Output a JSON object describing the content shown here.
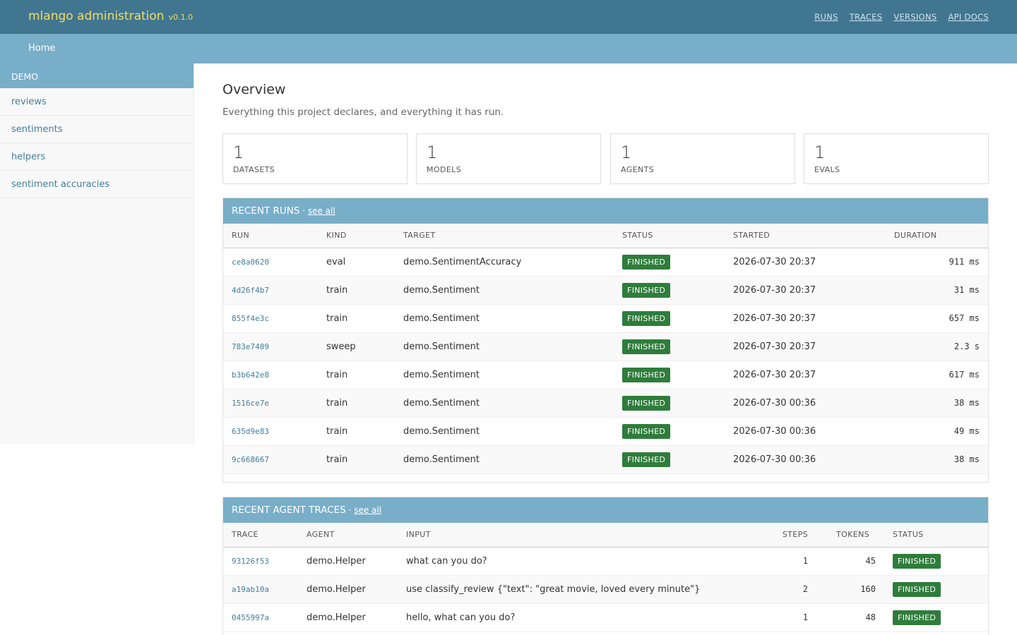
{
  "header": {
    "brand": "mlango administration",
    "version": "v0.1.0",
    "nav": [
      "RUNS",
      "TRACES",
      "VERSIONS",
      "API DOCS"
    ]
  },
  "breadcrumb": "Home",
  "sidebar": {
    "section": "DEMO",
    "items": [
      "reviews",
      "sentiments",
      "helpers",
      "sentiment accuracies"
    ]
  },
  "main": {
    "title": "Overview",
    "subtitle": "Everything this project declares, and everything it has run.",
    "cards": [
      {
        "value": "1",
        "label": "DATASETS"
      },
      {
        "value": "1",
        "label": "MODELS"
      },
      {
        "value": "1",
        "label": "AGENTS"
      },
      {
        "value": "1",
        "label": "EVALS"
      }
    ]
  },
  "runs": {
    "heading": "RECENT RUNS",
    "separator": " · ",
    "see_all": "see all",
    "columns": [
      "RUN",
      "KIND",
      "TARGET",
      "STATUS",
      "STARTED",
      "DURATION"
    ],
    "rows": [
      {
        "id": "ce8a0620",
        "kind": "eval",
        "target": "demo.SentimentAccuracy",
        "status": "FINISHED",
        "started": "2026-07-30 20:37",
        "duration": "911 ms"
      },
      {
        "id": "4d26f4b7",
        "kind": "train",
        "target": "demo.Sentiment",
        "status": "FINISHED",
        "started": "2026-07-30 20:37",
        "duration": "31 ms"
      },
      {
        "id": "855f4e3c",
        "kind": "train",
        "target": "demo.Sentiment",
        "status": "FINISHED",
        "started": "2026-07-30 20:37",
        "duration": "657 ms"
      },
      {
        "id": "783e7489",
        "kind": "sweep",
        "target": "demo.Sentiment",
        "status": "FINISHED",
        "started": "2026-07-30 20:37",
        "duration": "2.3 s"
      },
      {
        "id": "b3b642e8",
        "kind": "train",
        "target": "demo.Sentiment",
        "status": "FINISHED",
        "started": "2026-07-30 20:37",
        "duration": "617 ms"
      },
      {
        "id": "1516ce7e",
        "kind": "train",
        "target": "demo.Sentiment",
        "status": "FINISHED",
        "started": "2026-07-30 00:36",
        "duration": "38 ms"
      },
      {
        "id": "635d9e83",
        "kind": "train",
        "target": "demo.Sentiment",
        "status": "FINISHED",
        "started": "2026-07-30 00:36",
        "duration": "49 ms"
      },
      {
        "id": "9c668667",
        "kind": "train",
        "target": "demo.Sentiment",
        "status": "FINISHED",
        "started": "2026-07-30 00:36",
        "duration": "38 ms"
      }
    ]
  },
  "traces": {
    "heading": "RECENT AGENT TRACES",
    "separator": " · ",
    "see_all": "see all",
    "columns": [
      "TRACE",
      "AGENT",
      "INPUT",
      "STEPS",
      "TOKENS",
      "STATUS"
    ],
    "rows": [
      {
        "id": "93126f53",
        "agent": "demo.Helper",
        "input": "what can you do?",
        "steps": "1",
        "tokens": "45",
        "status": "FINISHED"
      },
      {
        "id": "a19ab10a",
        "agent": "demo.Helper",
        "input": "use classify_review {\"text\": \"great movie, loved every minute\"}",
        "steps": "2",
        "tokens": "160",
        "status": "FINISHED"
      },
      {
        "id": "0455997a",
        "agent": "demo.Helper",
        "input": "hello, what can you do?",
        "steps": "1",
        "tokens": "48",
        "status": "FINISHED"
      }
    ]
  },
  "colors": {
    "header_bg": "#417690",
    "subbar_bg": "#79aec8",
    "brand": "#f5dd5d",
    "link": "#447e9b",
    "badge_finished": "#2e7d3b"
  }
}
